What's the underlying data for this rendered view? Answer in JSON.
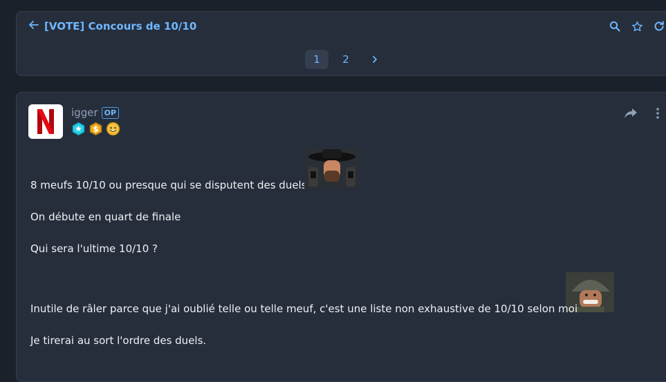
{
  "topic": {
    "title": "[VOTE] Concours de 10/10",
    "icons": [
      "arrow-left-icon",
      "search-icon",
      "star-icon",
      "refresh-icon"
    ]
  },
  "pagination": {
    "pages": [
      "1",
      "2"
    ],
    "current": "1",
    "next_icon": "chevron-right-icon"
  },
  "post": {
    "author": "igger",
    "op_badge": "OP",
    "avatar_icon": "netflix-n-logo",
    "badges": [
      "star-hexagon-badge",
      "dollar-coin-badge",
      "smiley-face-badge"
    ],
    "actions": [
      "share-icon",
      "more-vertical-icon"
    ],
    "lines": [
      "8 meufs 10/10 ou presque qui se disputent des duels",
      "On débute en quart de finale",
      "Qui sera l'ultime 10/10 ?",
      "Inutile de râler parce que j'ai oublié telle ou telle meuf, c'est une liste non exhaustive de 10/10 selon moi",
      "Je tirerai au sort l'ordre des duels."
    ],
    "stickers": [
      "cowboy-gunslinger-sticker",
      "soldier-helmet-sticker"
    ]
  },
  "colors": {
    "background": "#1b212b",
    "card": "#262e3c",
    "accent": "#6fb7ff",
    "netflix_red": "#e50914"
  }
}
